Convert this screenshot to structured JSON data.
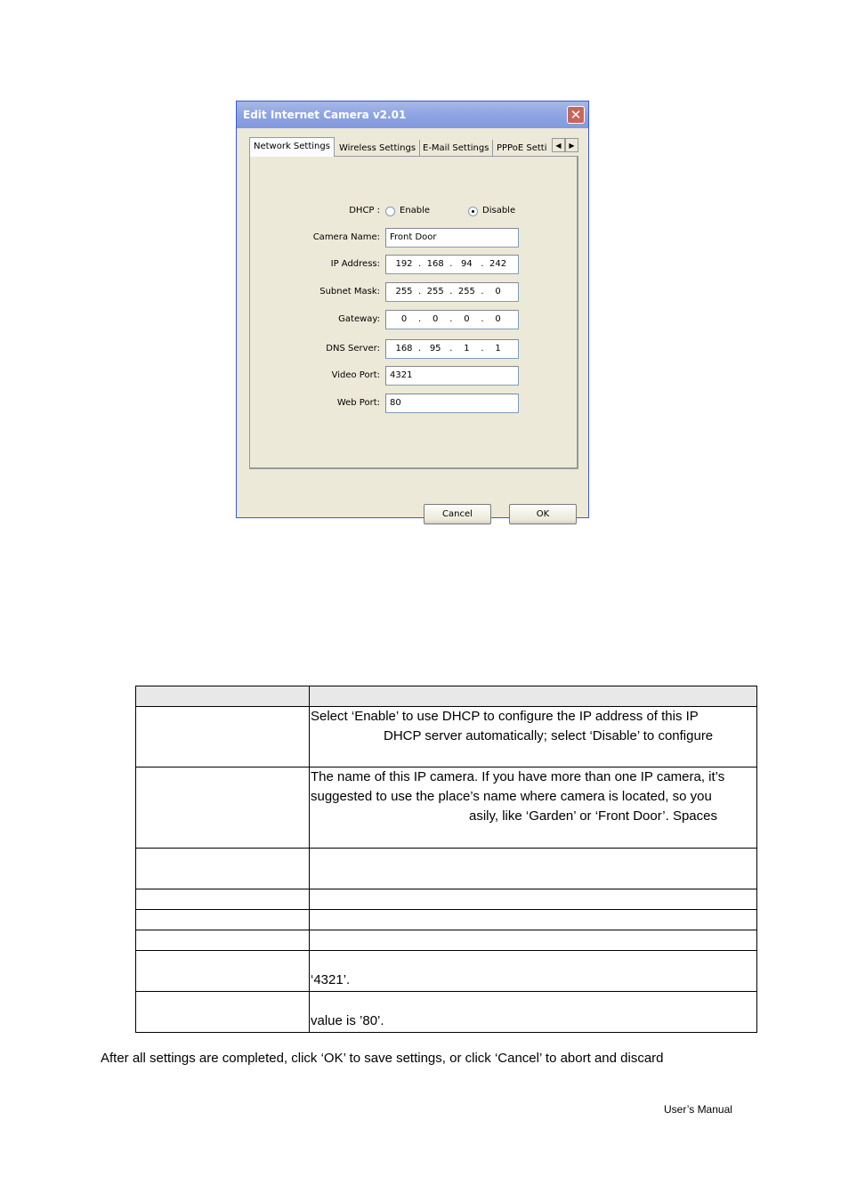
{
  "dialog": {
    "title": "Edit Internet Camera v2.01",
    "close_icon": "close-icon",
    "tabs": [
      {
        "label": "Network Settings",
        "active": true
      },
      {
        "label": "Wireless Settings",
        "active": false
      },
      {
        "label": "E-Mail Settings",
        "active": false
      },
      {
        "label": "PPPoE Setti",
        "active": false
      }
    ],
    "tab_scroll_left": "◀",
    "tab_scroll_right": "▶",
    "dhcp": {
      "label": "DHCP :",
      "options": [
        {
          "label": "Enable",
          "checked": false
        },
        {
          "label": "Disable",
          "checked": true
        }
      ]
    },
    "fields": {
      "camera_name": {
        "label": "Camera Name:",
        "value": "Front Door"
      },
      "ip_address": {
        "label": "IP Address:",
        "octets": [
          "192",
          "168",
          "94",
          "242"
        ]
      },
      "subnet_mask": {
        "label": "Subnet Mask:",
        "octets": [
          "255",
          "255",
          "255",
          "0"
        ]
      },
      "gateway": {
        "label": "Gateway:",
        "octets": [
          "0",
          "0",
          "0",
          "0"
        ]
      },
      "dns_server": {
        "label": "DNS Server:",
        "octets": [
          "168",
          "95",
          "1",
          "1"
        ]
      },
      "video_port": {
        "label": "Video Port:",
        "value": "4321"
      },
      "web_port": {
        "label": "Web Port:",
        "value": "80"
      }
    },
    "buttons": {
      "cancel": "Cancel",
      "ok": "OK"
    }
  },
  "table": {
    "header": [
      "",
      ""
    ],
    "rows": [
      {
        "c1": "",
        "lines": [
          "Select ‘Enable’ to use DHCP to configure the IP address of this IP",
          "DHCP server automatically; select ‘Disable’ to configure"
        ]
      },
      {
        "c1": "",
        "lines": [
          "The name of this IP camera. If you have more than one IP camera, it’s",
          "suggested to use the place’s name where camera is located, so you",
          "asily, like ‘Garden’ or ‘Front Door’. Spaces"
        ]
      },
      {
        "c1": "",
        "lines": []
      },
      {
        "c1": "",
        "lines": []
      },
      {
        "c1": "",
        "lines": []
      },
      {
        "c1": "",
        "lines": []
      },
      {
        "c1": "",
        "lines": [
          "",
          "‘4321’."
        ]
      },
      {
        "c1": "",
        "lines": [
          "",
          "value is ’80’."
        ]
      }
    ]
  },
  "footer_text": "After all settings are completed, click ‘OK’ to save settings, or click ‘Cancel’ to abort and discard",
  "page_footer": "User’s Manual"
}
